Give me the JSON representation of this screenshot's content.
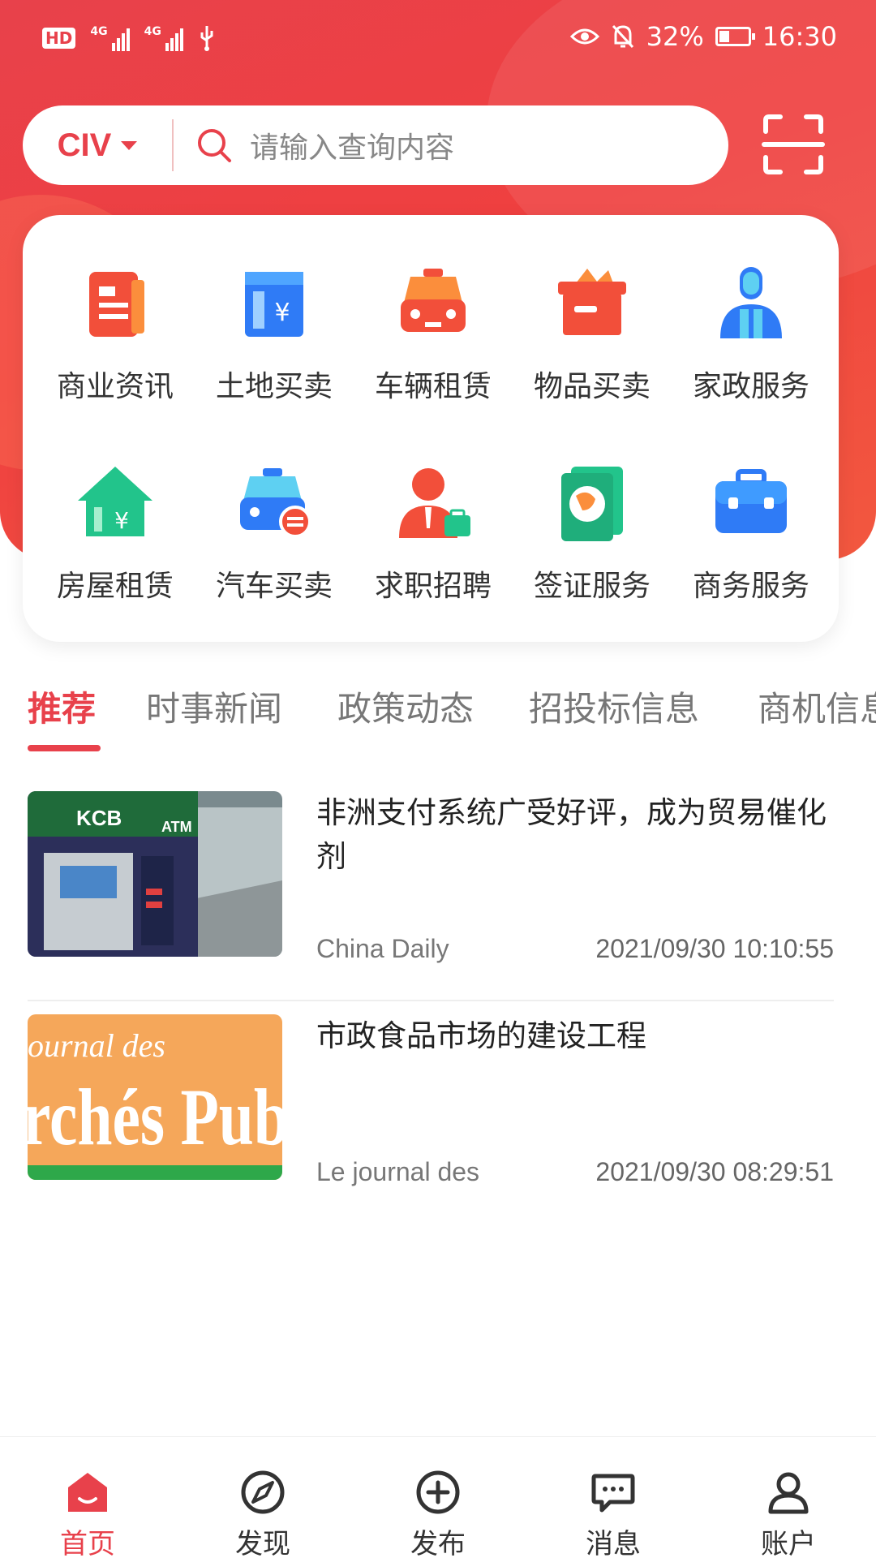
{
  "status_bar": {
    "battery": "32%",
    "time": "16:30",
    "network_1": "4G",
    "network_2": "4G",
    "hd": "HD"
  },
  "search": {
    "region": "CIV",
    "placeholder": "请输入查询内容"
  },
  "categories": [
    {
      "label": "商业资讯",
      "icon": "news-icon"
    },
    {
      "label": "土地买卖",
      "icon": "land-icon"
    },
    {
      "label": "车辆租赁",
      "icon": "car-rental-icon"
    },
    {
      "label": "物品买卖",
      "icon": "goods-box-icon"
    },
    {
      "label": "家政服务",
      "icon": "housekeeping-icon"
    },
    {
      "label": "房屋租赁",
      "icon": "house-icon"
    },
    {
      "label": "汽车买卖",
      "icon": "car-trade-icon"
    },
    {
      "label": "求职招聘",
      "icon": "job-icon"
    },
    {
      "label": "签证服务",
      "icon": "visa-icon"
    },
    {
      "label": "商务服务",
      "icon": "briefcase-icon"
    }
  ],
  "tabs": [
    "推荐",
    "时事新闻",
    "政策动态",
    "招投标信息",
    "商机信息"
  ],
  "news": [
    {
      "title": "非洲支付系统广受好评，成为贸易催化剂",
      "source": "China Daily",
      "time": "2021/09/30 10:10:55",
      "thumb_text_1": "KCB",
      "thumb_text_2": "ATM"
    },
    {
      "title": "市政食品市场的建设工程",
      "source": "Le journal des",
      "time": "2021/09/30 08:29:51",
      "thumb_text_1": "ournal des",
      "thumb_text_2": "rchés Pub"
    }
  ],
  "bottom_nav": [
    {
      "label": "首页",
      "icon": "home-icon"
    },
    {
      "label": "发现",
      "icon": "compass-icon"
    },
    {
      "label": "发布",
      "icon": "plus-circle-icon"
    },
    {
      "label": "消息",
      "icon": "message-icon"
    },
    {
      "label": "账户",
      "icon": "user-icon"
    }
  ],
  "colors": {
    "accent": "#e8414b"
  }
}
